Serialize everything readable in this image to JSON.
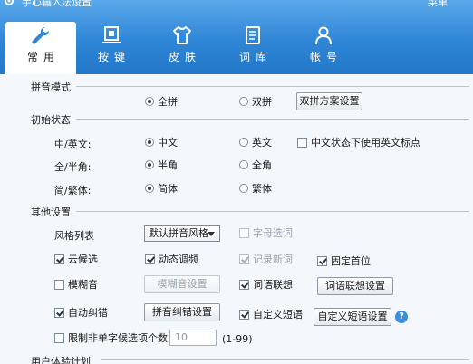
{
  "window": {
    "title": "手心输入法设置",
    "menu_label": "菜单"
  },
  "tabs": [
    {
      "label": "常用",
      "icon": "wrench-icon"
    },
    {
      "label": "按键",
      "icon": "keyboard-icon"
    },
    {
      "label": "皮肤",
      "icon": "tshirt-icon"
    },
    {
      "label": "词库",
      "icon": "dictionary-icon"
    },
    {
      "label": "帐号",
      "icon": "user-icon"
    }
  ],
  "sections": {
    "pinyin_mode": "拼音模式",
    "initial_state": "初始状态",
    "other": "其他设置",
    "user_plan": "用户体验计划"
  },
  "pinyin_mode": {
    "quanpin": "全拼",
    "shuangpin": "双拼",
    "shuangpin_button": "双拼方案设置"
  },
  "initial_state": {
    "lang_label": "中/英文:",
    "lang_cn": "中文",
    "lang_en": "英文",
    "cn_punct": "中文状态下使用英文标点",
    "width_label": "全/半角:",
    "half": "半角",
    "full": "全角",
    "script_label": "简/繁体:",
    "simplified": "简体",
    "traditional": "繁体"
  },
  "other": {
    "style_label": "风格列表",
    "style_value": "默认拼音风格",
    "letter_select": "字母选词",
    "cloud": "云候选",
    "dynamic_freq": "动态调频",
    "record_new": "记录新词",
    "fix_first": "固定首位",
    "fuzzy": "模糊音",
    "fuzzy_button": "模糊音设置",
    "assoc": "词语联想",
    "assoc_button": "词语联想设置",
    "autocorrect": "自动纠错",
    "autocorrect_button": "拼音纠错设置",
    "custom_phrase": "自定义短语",
    "custom_phrase_button": "自定义短语设置",
    "help": "?",
    "limit_label": "限制非单字候选项个数",
    "limit_value": "10",
    "limit_range": "(1-99)"
  },
  "colors": {
    "header": "#2f86d6",
    "accent": "#3a8ee0"
  }
}
